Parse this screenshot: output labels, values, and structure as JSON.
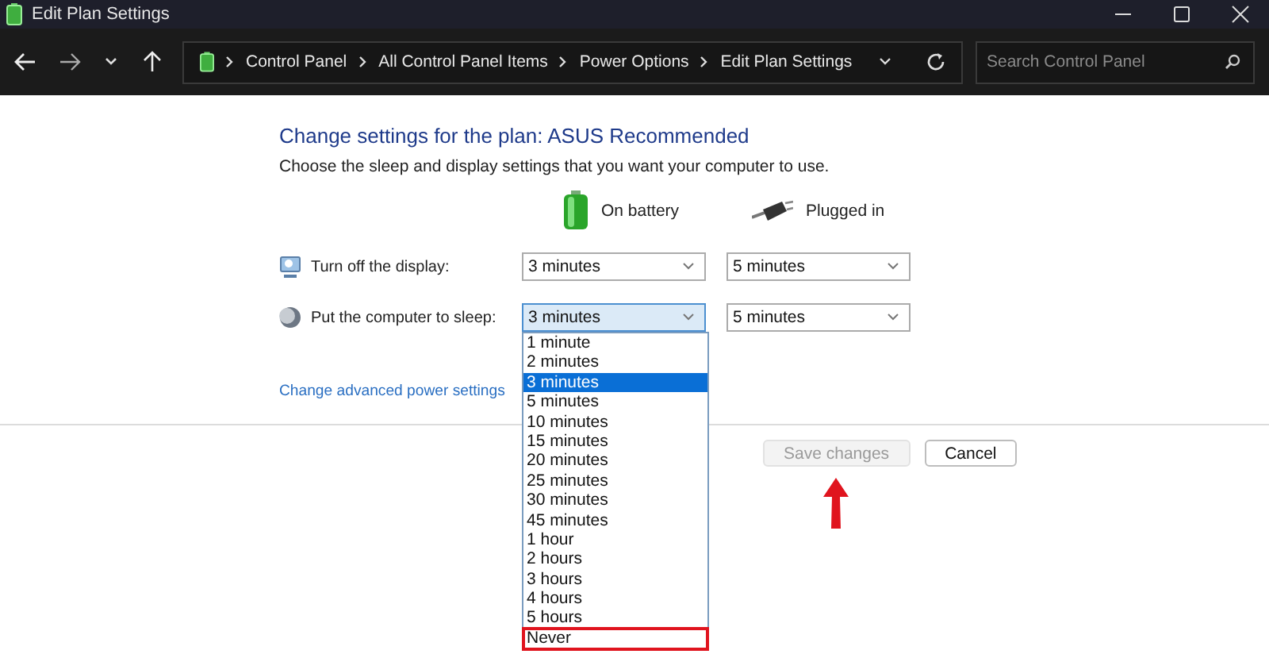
{
  "window": {
    "title": "Edit Plan Settings"
  },
  "address_bar": {
    "breadcrumbs": [
      "Control Panel",
      "All Control Panel Items",
      "Power Options",
      "Edit Plan Settings"
    ]
  },
  "search": {
    "placeholder": "Search Control Panel"
  },
  "heading": "Change settings for the plan: ASUS Recommended",
  "description": "Choose the sleep and display settings that you want your computer to use.",
  "columns": [
    {
      "label": "On battery",
      "kind": "battery"
    },
    {
      "label": "Plugged in",
      "kind": "plug"
    }
  ],
  "settings": [
    {
      "label": "Turn off the display:",
      "kind": "display",
      "values": [
        {
          "value": "3 minutes",
          "focused": false
        },
        {
          "value": "5 minutes",
          "focused": false
        }
      ]
    },
    {
      "label": "Put the computer to sleep:",
      "kind": "sleep",
      "values": [
        {
          "value": "3 minutes",
          "focused": true
        },
        {
          "value": "5 minutes",
          "focused": false
        }
      ]
    }
  ],
  "dropdown": {
    "options": [
      {
        "label": "1 minute",
        "selected": false,
        "highlighted": false
      },
      {
        "label": "2 minutes",
        "selected": false,
        "highlighted": false
      },
      {
        "label": "3 minutes",
        "selected": true,
        "highlighted": false
      },
      {
        "label": "5 minutes",
        "selected": false,
        "highlighted": false
      },
      {
        "label": "10 minutes",
        "selected": false,
        "highlighted": false
      },
      {
        "label": "15 minutes",
        "selected": false,
        "highlighted": false
      },
      {
        "label": "20 minutes",
        "selected": false,
        "highlighted": false
      },
      {
        "label": "25 minutes",
        "selected": false,
        "highlighted": false
      },
      {
        "label": "30 minutes",
        "selected": false,
        "highlighted": false
      },
      {
        "label": "45 minutes",
        "selected": false,
        "highlighted": false
      },
      {
        "label": "1 hour",
        "selected": false,
        "highlighted": false
      },
      {
        "label": "2 hours",
        "selected": false,
        "highlighted": false
      },
      {
        "label": "3 hours",
        "selected": false,
        "highlighted": false
      },
      {
        "label": "4 hours",
        "selected": false,
        "highlighted": false
      },
      {
        "label": "5 hours",
        "selected": false,
        "highlighted": false
      },
      {
        "label": "Never",
        "selected": false,
        "highlighted": true
      }
    ]
  },
  "advanced_link": "Change advanced power settings",
  "buttons": [
    {
      "label": "Save changes",
      "disabled": true,
      "pointed": true
    },
    {
      "label": "Cancel",
      "disabled": false,
      "pointed": false
    }
  ]
}
